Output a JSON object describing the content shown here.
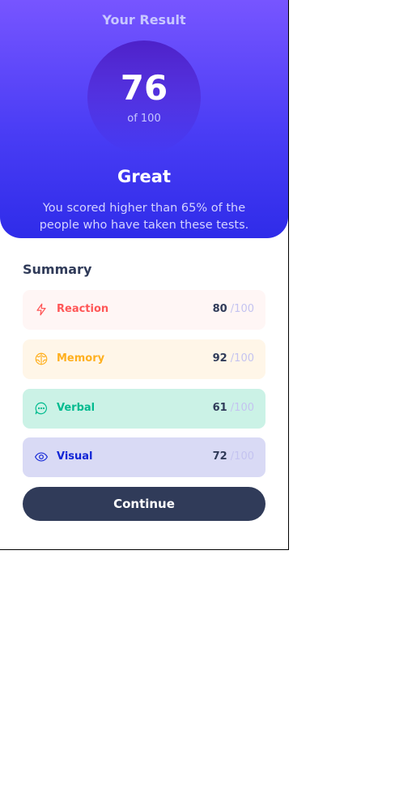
{
  "result": {
    "title": "Your Result",
    "score": "76",
    "score_max": "of 100",
    "rating": "Great",
    "description": "You scored higher than 65% of the people who have taken these tests."
  },
  "summary": {
    "title": "Summary",
    "items": [
      {
        "label": "Reaction",
        "score": "80",
        "max": "/100",
        "icon": "lightning-icon",
        "color": "#ff5757",
        "bg": "#fff6f5"
      },
      {
        "label": "Memory",
        "score": "92",
        "max": "/100",
        "icon": "brain-icon",
        "color": "#ffb01f",
        "bg": "#fff6e8"
      },
      {
        "label": "Verbal",
        "score": "61",
        "max": "/100",
        "icon": "chat-bubble-icon",
        "color": "#00bb8f",
        "bg": "#cbf2e6"
      },
      {
        "label": "Visual",
        "score": "72",
        "max": "/100",
        "icon": "eye-icon",
        "color": "#1125d6",
        "bg": "#d9daf5"
      }
    ]
  },
  "continue_label": "Continue",
  "colors": {
    "gradient_top": "#7755ff",
    "gradient_bottom": "#2f2ce9",
    "dark_slate": "#303b59"
  }
}
